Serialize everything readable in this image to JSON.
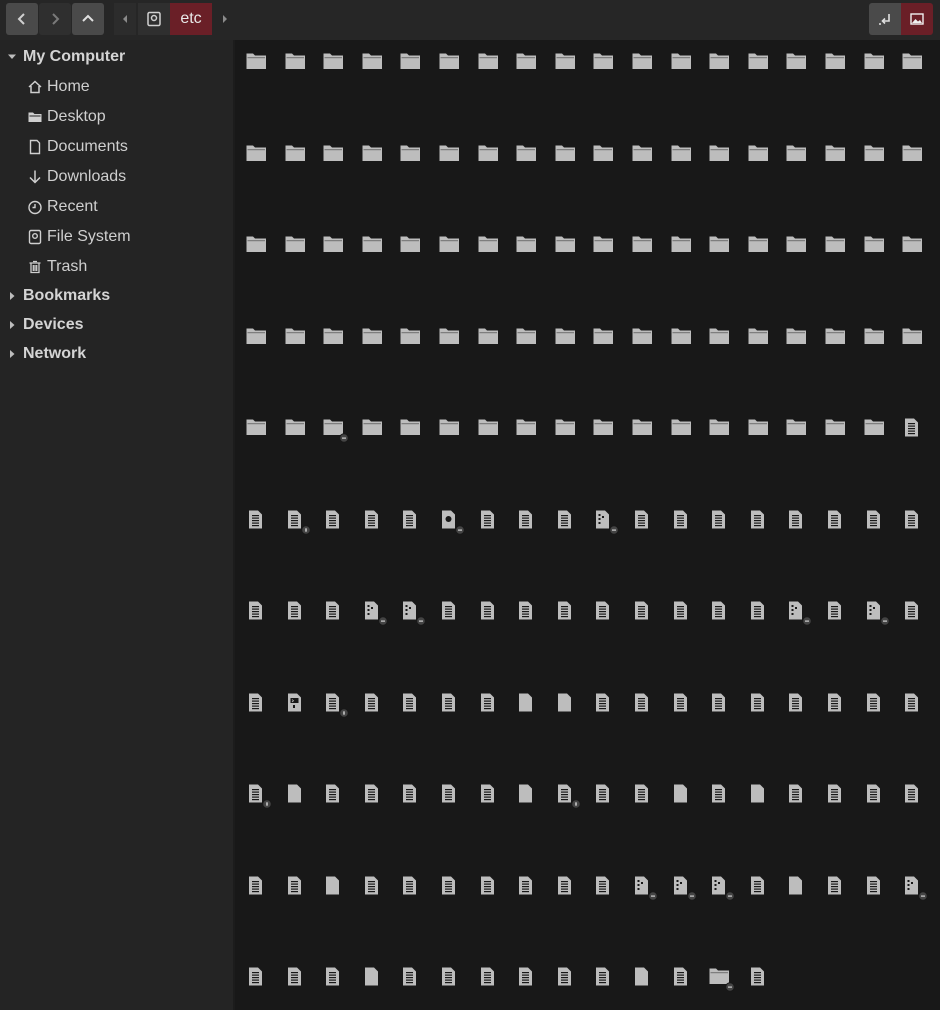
{
  "toolbar": {
    "back_icon": "chevron-left-icon",
    "forward_icon": "chevron-right-icon",
    "up_icon": "chevron-up-icon",
    "breadcrumb": {
      "current": "etc",
      "root_icon": "drive-icon"
    },
    "accent": "#6a1f27"
  },
  "sidebar": {
    "my_computer": {
      "label": "My Computer",
      "items": [
        {
          "label": "Home",
          "icon": "home-icon"
        },
        {
          "label": "Desktop",
          "icon": "folder-icon"
        },
        {
          "label": "Documents",
          "icon": "document-icon"
        },
        {
          "label": "Downloads",
          "icon": "download-icon"
        },
        {
          "label": "Recent",
          "icon": "clock-icon"
        },
        {
          "label": "File System",
          "icon": "drive-icon"
        },
        {
          "label": "Trash",
          "icon": "trash-icon"
        }
      ]
    },
    "bookmarks": {
      "label": "Bookmarks"
    },
    "devices": {
      "label": "Devices"
    },
    "network": {
      "label": "Network"
    }
  },
  "files": {
    "columns": 18,
    "rows": [
      "FFFFFFFFFFFFFFFFFF",
      "FFFFFFFFFFFFFFFFFF",
      "FFFFFFFFFFFFFFFFFF",
      "FFFFFFFFFFFFFFFFFF",
      "FFLFFFFFFFFFFFFFFT",
      "TSTTTGTTTBTTTTTTTT",
      "TTTBBTTTTTTTTTBTBT",
      "TXSTTTTPPTTTTTTTTT",
      "SPTTTTTPSTTPTPTTTT",
      "TTPTTTTTTTBBBTPTTB",
      "TTTPTTTTTTPTLT"
    ],
    "legend": {
      "F": "folder-icon",
      "L": "folder-link-icon",
      "T": "text-file-icon",
      "S": "script-file-icon",
      "G": "gear-file-icon",
      "B": "binary-link-file-icon",
      "P": "plain-file-icon",
      "X": "executable-file-icon"
    }
  }
}
